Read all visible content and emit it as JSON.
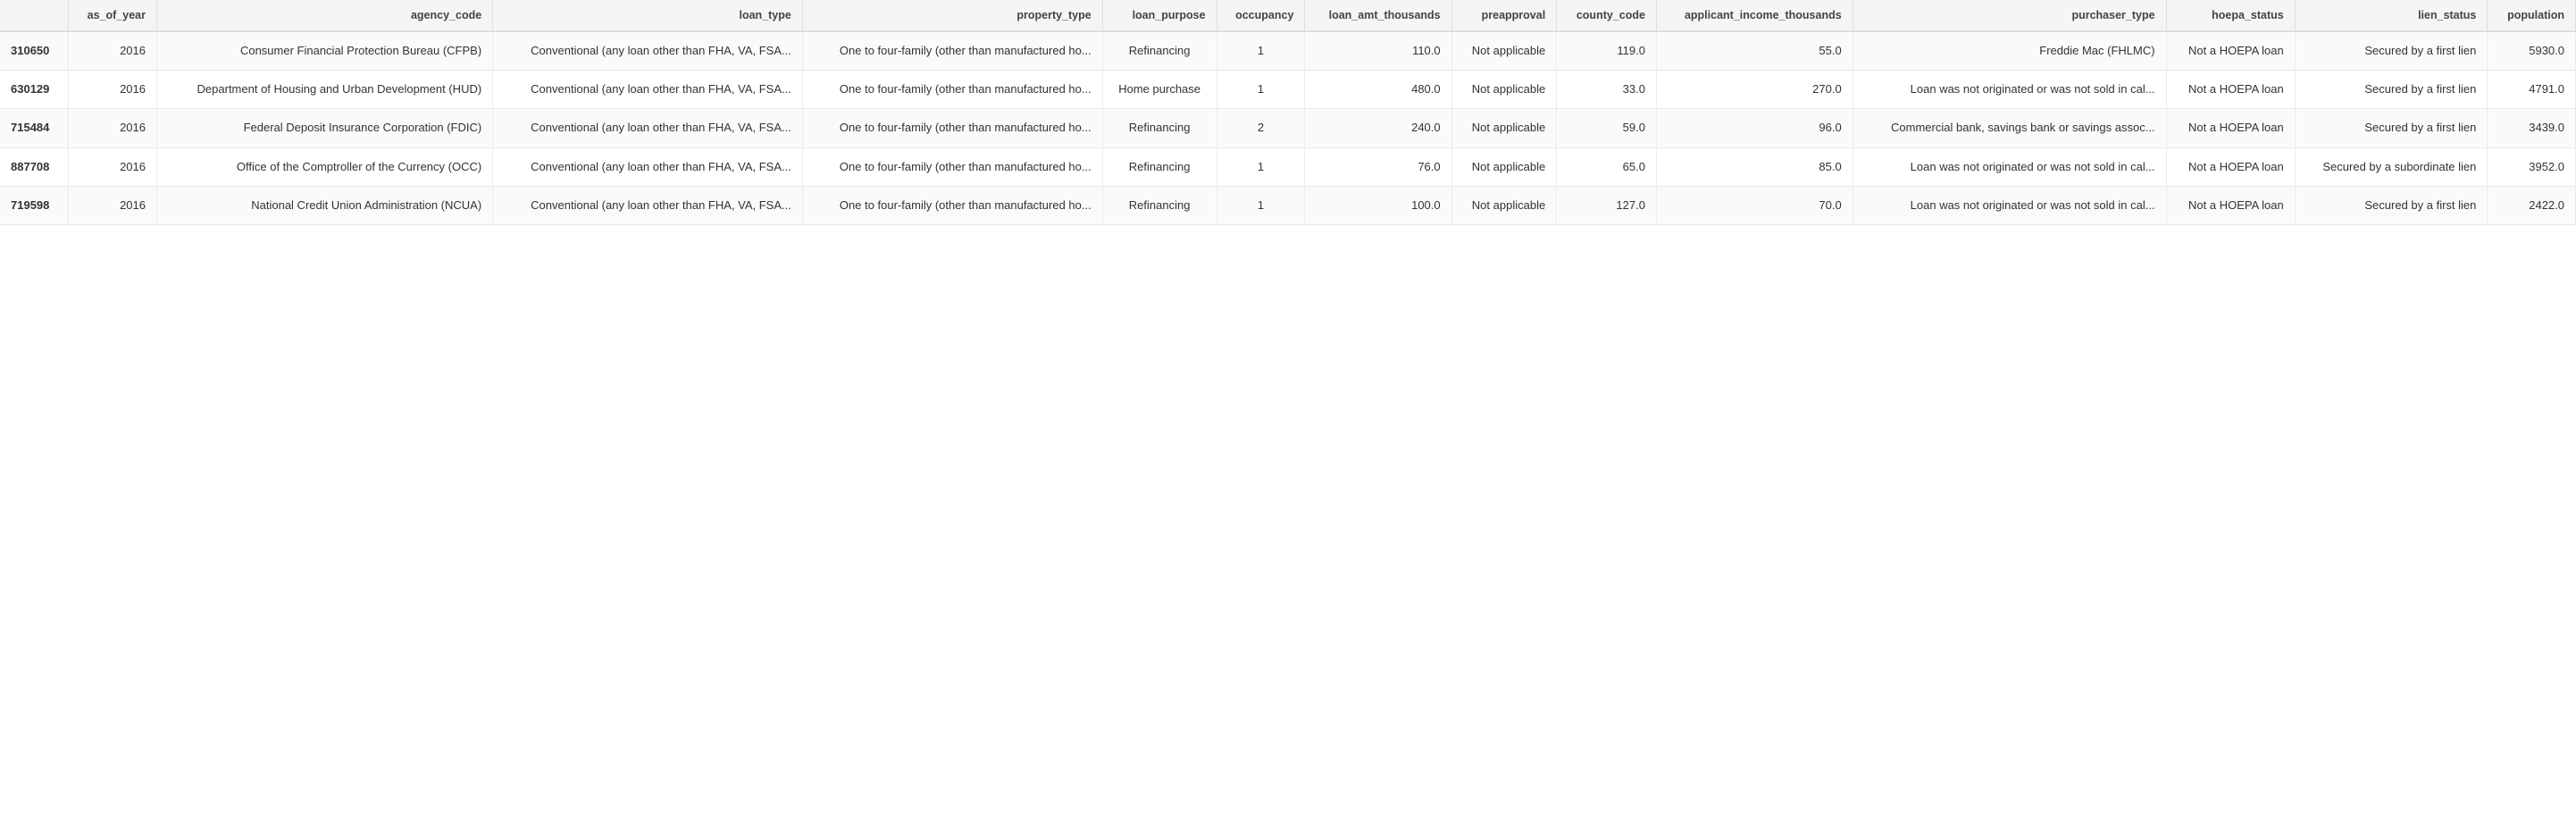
{
  "table": {
    "columns": [
      {
        "key": "id",
        "label": "",
        "class": "col-id"
      },
      {
        "key": "as_of_year",
        "label": "as_of_year",
        "class": "col-year"
      },
      {
        "key": "agency_code",
        "label": "agency_code",
        "class": "col-agency"
      },
      {
        "key": "loan_type",
        "label": "loan_type",
        "class": "col-loan-type"
      },
      {
        "key": "property_type",
        "label": "property_type",
        "class": "col-property"
      },
      {
        "key": "loan_purpose",
        "label": "loan_purpose",
        "class": "col-purpose"
      },
      {
        "key": "occupancy",
        "label": "occupancy",
        "class": "col-occupancy"
      },
      {
        "key": "loan_amt_thousands",
        "label": "loan_amt_thousands",
        "class": "col-loan-amt"
      },
      {
        "key": "preapproval",
        "label": "preapproval",
        "class": "col-preapproval"
      },
      {
        "key": "county_code",
        "label": "county_code",
        "class": "col-county"
      },
      {
        "key": "applicant_income_thousands",
        "label": "applicant_income_thousands",
        "class": "col-income"
      },
      {
        "key": "purchaser_type",
        "label": "purchaser_type",
        "class": "col-purchaser"
      },
      {
        "key": "hoepa_status",
        "label": "hoepa_status",
        "class": "col-hoepa"
      },
      {
        "key": "lien_status",
        "label": "lien_status",
        "class": "col-lien"
      },
      {
        "key": "population",
        "label": "population",
        "class": "col-population"
      }
    ],
    "rows": [
      {
        "id": "310650",
        "as_of_year": "2016",
        "agency_code": "Consumer Financial Protection Bureau (CFPB)",
        "loan_type": "Conventional (any loan other than FHA, VA, FSA...",
        "property_type": "One to four-family (other than manufactured ho...",
        "loan_purpose": "Refinancing",
        "occupancy": "1",
        "loan_amt_thousands": "110.0",
        "preapproval": "Not applicable",
        "county_code": "119.0",
        "applicant_income_thousands": "55.0",
        "purchaser_type": "Freddie Mac (FHLMC)",
        "hoepa_status": "Not a HOEPA loan",
        "lien_status": "Secured by a first lien",
        "population": "5930.0"
      },
      {
        "id": "630129",
        "as_of_year": "2016",
        "agency_code": "Department of Housing and Urban Development (HUD)",
        "loan_type": "Conventional (any loan other than FHA, VA, FSA...",
        "property_type": "One to four-family (other than manufactured ho...",
        "loan_purpose": "Home purchase",
        "occupancy": "1",
        "loan_amt_thousands": "480.0",
        "preapproval": "Not applicable",
        "county_code": "33.0",
        "applicant_income_thousands": "270.0",
        "purchaser_type": "Loan was not originated or was not sold in cal...",
        "hoepa_status": "Not a HOEPA loan",
        "lien_status": "Secured by a first lien",
        "population": "4791.0"
      },
      {
        "id": "715484",
        "as_of_year": "2016",
        "agency_code": "Federal Deposit Insurance Corporation (FDIC)",
        "loan_type": "Conventional (any loan other than FHA, VA, FSA...",
        "property_type": "One to four-family (other than manufactured ho...",
        "loan_purpose": "Refinancing",
        "occupancy": "2",
        "loan_amt_thousands": "240.0",
        "preapproval": "Not applicable",
        "county_code": "59.0",
        "applicant_income_thousands": "96.0",
        "purchaser_type": "Commercial bank, savings bank or savings assoc...",
        "hoepa_status": "Not a HOEPA loan",
        "lien_status": "Secured by a first lien",
        "population": "3439.0"
      },
      {
        "id": "887708",
        "as_of_year": "2016",
        "agency_code": "Office of the Comptroller of the Currency (OCC)",
        "loan_type": "Conventional (any loan other than FHA, VA, FSA...",
        "property_type": "One to four-family (other than manufactured ho...",
        "loan_purpose": "Refinancing",
        "occupancy": "1",
        "loan_amt_thousands": "76.0",
        "preapproval": "Not applicable",
        "county_code": "65.0",
        "applicant_income_thousands": "85.0",
        "purchaser_type": "Loan was not originated or was not sold in cal...",
        "hoepa_status": "Not a HOEPA loan",
        "lien_status": "Secured by a subordinate lien",
        "population": "3952.0"
      },
      {
        "id": "719598",
        "as_of_year": "2016",
        "agency_code": "National Credit Union Administration (NCUA)",
        "loan_type": "Conventional (any loan other than FHA, VA, FSA...",
        "property_type": "One to four-family (other than manufactured ho...",
        "loan_purpose": "Refinancing",
        "occupancy": "1",
        "loan_amt_thousands": "100.0",
        "preapproval": "Not applicable",
        "county_code": "127.0",
        "applicant_income_thousands": "70.0",
        "purchaser_type": "Loan was not originated or was not sold in cal...",
        "hoepa_status": "Not a HOEPA loan",
        "lien_status": "Secured by a first lien",
        "population": "2422.0"
      }
    ]
  }
}
